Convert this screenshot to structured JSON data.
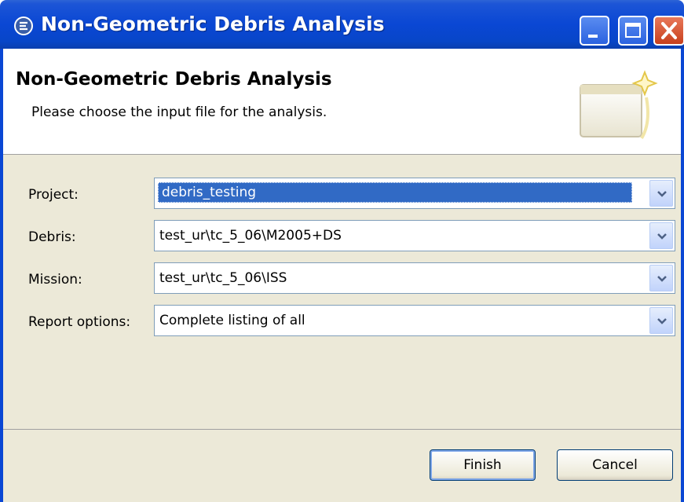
{
  "window": {
    "title": "Non-Geometric Debris Analysis",
    "controls": [
      "minimize",
      "maximize",
      "close"
    ]
  },
  "header": {
    "title": "Non-Geometric Debris Analysis",
    "description": "Please choose the input file for the analysis."
  },
  "form": {
    "project": {
      "label": "Project:",
      "value": "debris_testing"
    },
    "debris": {
      "label": "Debris:",
      "value": "test_ur\\tc_5_06\\M2005+DS"
    },
    "mission": {
      "label": "Mission:",
      "value": "test_ur\\tc_5_06\\ISS"
    },
    "report": {
      "label": "Report options:",
      "value": "Complete listing of all"
    }
  },
  "footer": {
    "finish_label": "Finish",
    "cancel_label": "Cancel"
  },
  "icons": {
    "title_icon": "eclipse-app-icon",
    "header_graphic": "wizard-banner-icon",
    "dropdown_arrow": "chevron-down-icon"
  },
  "colors": {
    "titlebar": "#0a47d4",
    "selection": "#316ac5",
    "dialog_bg": "#ece9d8"
  }
}
